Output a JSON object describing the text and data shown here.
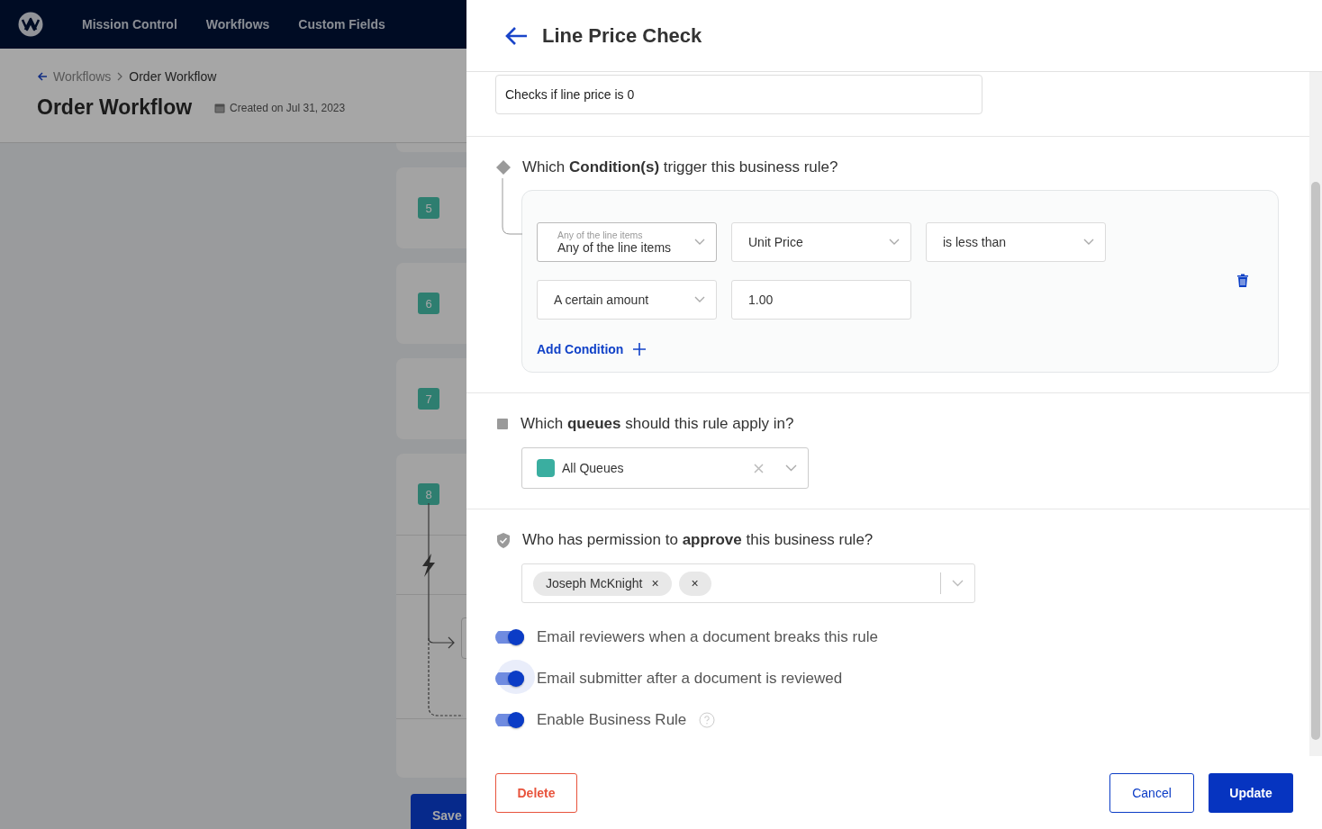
{
  "nav": {
    "items": [
      "Mission Control",
      "Workflows",
      "Custom Fields"
    ]
  },
  "breadcrumb": {
    "parent": "Workflows",
    "current": "Order Workflow"
  },
  "page": {
    "title": "Order Workflow",
    "created": "Created on Jul 31, 2023"
  },
  "steps": [
    {
      "number": "5",
      "expanded": false
    },
    {
      "number": "6",
      "expanded": false
    },
    {
      "number": "7",
      "expanded": false
    },
    {
      "number": "8",
      "expanded": true
    }
  ],
  "save_button": "Save",
  "panel": {
    "title": "Line Price Check",
    "description": "Checks if line price is 0",
    "conditions": {
      "question": "Which **Condition(s)** trigger this business rule?",
      "rows": [
        [
          {
            "kind": "select",
            "label": "Any of the line items",
            "value": "Any of the line items"
          },
          {
            "kind": "select",
            "value": "Unit Price"
          },
          {
            "kind": "select",
            "value": "is less than"
          }
        ],
        [
          {
            "kind": "select",
            "value": "A certain amount"
          },
          {
            "kind": "input",
            "value": "1.00"
          }
        ]
      ],
      "add": "Add Condition"
    },
    "queues": {
      "question": "Which **queues** should this rule apply in?",
      "label": "All Queues",
      "color": "#3aaea0"
    },
    "approvers": {
      "question": "Who has permission to **approve** this business rule?",
      "chips": [
        {
          "label": "Joseph McKnight",
          "remove": "×"
        },
        {
          "remove": "×"
        }
      ]
    },
    "toggles": [
      {
        "label": "Email reviewers when a document breaks this rule",
        "on": true,
        "focused": false,
        "help": false
      },
      {
        "label": "Email submitter after a document is reviewed",
        "on": true,
        "focused": true,
        "help": false
      },
      {
        "label": "Enable Business Rule",
        "on": true,
        "focused": false,
        "help": true
      }
    ],
    "buttons": [
      {
        "label": "Delete",
        "kind": "danger"
      },
      {
        "label": "Cancel",
        "kind": "secondary"
      },
      {
        "label": "Update",
        "kind": "primary"
      }
    ]
  }
}
